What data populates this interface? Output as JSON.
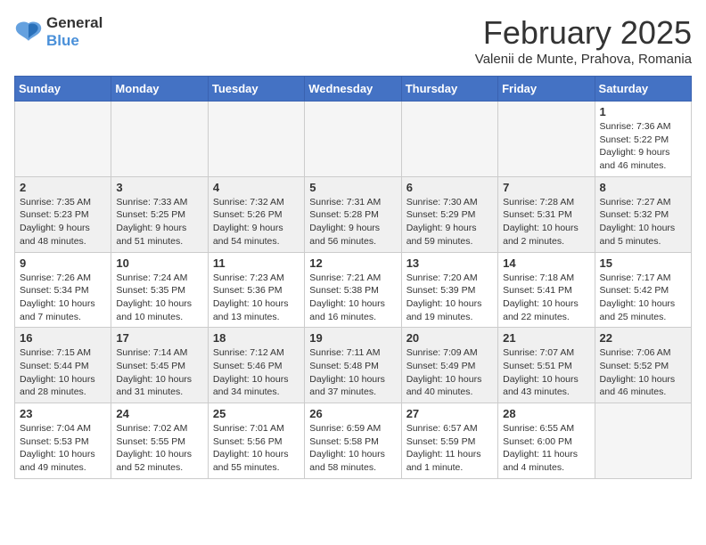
{
  "logo": {
    "line1": "General",
    "line2": "Blue"
  },
  "title": "February 2025",
  "subtitle": "Valenii de Munte, Prahova, Romania",
  "weekdays": [
    "Sunday",
    "Monday",
    "Tuesday",
    "Wednesday",
    "Thursday",
    "Friday",
    "Saturday"
  ],
  "weeks": [
    [
      {
        "day": "",
        "info": ""
      },
      {
        "day": "",
        "info": ""
      },
      {
        "day": "",
        "info": ""
      },
      {
        "day": "",
        "info": ""
      },
      {
        "day": "",
        "info": ""
      },
      {
        "day": "",
        "info": ""
      },
      {
        "day": "1",
        "info": "Sunrise: 7:36 AM\nSunset: 5:22 PM\nDaylight: 9 hours and 46 minutes."
      }
    ],
    [
      {
        "day": "2",
        "info": "Sunrise: 7:35 AM\nSunset: 5:23 PM\nDaylight: 9 hours and 48 minutes."
      },
      {
        "day": "3",
        "info": "Sunrise: 7:33 AM\nSunset: 5:25 PM\nDaylight: 9 hours and 51 minutes."
      },
      {
        "day": "4",
        "info": "Sunrise: 7:32 AM\nSunset: 5:26 PM\nDaylight: 9 hours and 54 minutes."
      },
      {
        "day": "5",
        "info": "Sunrise: 7:31 AM\nSunset: 5:28 PM\nDaylight: 9 hours and 56 minutes."
      },
      {
        "day": "6",
        "info": "Sunrise: 7:30 AM\nSunset: 5:29 PM\nDaylight: 9 hours and 59 minutes."
      },
      {
        "day": "7",
        "info": "Sunrise: 7:28 AM\nSunset: 5:31 PM\nDaylight: 10 hours and 2 minutes."
      },
      {
        "day": "8",
        "info": "Sunrise: 7:27 AM\nSunset: 5:32 PM\nDaylight: 10 hours and 5 minutes."
      }
    ],
    [
      {
        "day": "9",
        "info": "Sunrise: 7:26 AM\nSunset: 5:34 PM\nDaylight: 10 hours and 7 minutes."
      },
      {
        "day": "10",
        "info": "Sunrise: 7:24 AM\nSunset: 5:35 PM\nDaylight: 10 hours and 10 minutes."
      },
      {
        "day": "11",
        "info": "Sunrise: 7:23 AM\nSunset: 5:36 PM\nDaylight: 10 hours and 13 minutes."
      },
      {
        "day": "12",
        "info": "Sunrise: 7:21 AM\nSunset: 5:38 PM\nDaylight: 10 hours and 16 minutes."
      },
      {
        "day": "13",
        "info": "Sunrise: 7:20 AM\nSunset: 5:39 PM\nDaylight: 10 hours and 19 minutes."
      },
      {
        "day": "14",
        "info": "Sunrise: 7:18 AM\nSunset: 5:41 PM\nDaylight: 10 hours and 22 minutes."
      },
      {
        "day": "15",
        "info": "Sunrise: 7:17 AM\nSunset: 5:42 PM\nDaylight: 10 hours and 25 minutes."
      }
    ],
    [
      {
        "day": "16",
        "info": "Sunrise: 7:15 AM\nSunset: 5:44 PM\nDaylight: 10 hours and 28 minutes."
      },
      {
        "day": "17",
        "info": "Sunrise: 7:14 AM\nSunset: 5:45 PM\nDaylight: 10 hours and 31 minutes."
      },
      {
        "day": "18",
        "info": "Sunrise: 7:12 AM\nSunset: 5:46 PM\nDaylight: 10 hours and 34 minutes."
      },
      {
        "day": "19",
        "info": "Sunrise: 7:11 AM\nSunset: 5:48 PM\nDaylight: 10 hours and 37 minutes."
      },
      {
        "day": "20",
        "info": "Sunrise: 7:09 AM\nSunset: 5:49 PM\nDaylight: 10 hours and 40 minutes."
      },
      {
        "day": "21",
        "info": "Sunrise: 7:07 AM\nSunset: 5:51 PM\nDaylight: 10 hours and 43 minutes."
      },
      {
        "day": "22",
        "info": "Sunrise: 7:06 AM\nSunset: 5:52 PM\nDaylight: 10 hours and 46 minutes."
      }
    ],
    [
      {
        "day": "23",
        "info": "Sunrise: 7:04 AM\nSunset: 5:53 PM\nDaylight: 10 hours and 49 minutes."
      },
      {
        "day": "24",
        "info": "Sunrise: 7:02 AM\nSunset: 5:55 PM\nDaylight: 10 hours and 52 minutes."
      },
      {
        "day": "25",
        "info": "Sunrise: 7:01 AM\nSunset: 5:56 PM\nDaylight: 10 hours and 55 minutes."
      },
      {
        "day": "26",
        "info": "Sunrise: 6:59 AM\nSunset: 5:58 PM\nDaylight: 10 hours and 58 minutes."
      },
      {
        "day": "27",
        "info": "Sunrise: 6:57 AM\nSunset: 5:59 PM\nDaylight: 11 hours and 1 minute."
      },
      {
        "day": "28",
        "info": "Sunrise: 6:55 AM\nSunset: 6:00 PM\nDaylight: 11 hours and 4 minutes."
      },
      {
        "day": "",
        "info": ""
      }
    ]
  ]
}
